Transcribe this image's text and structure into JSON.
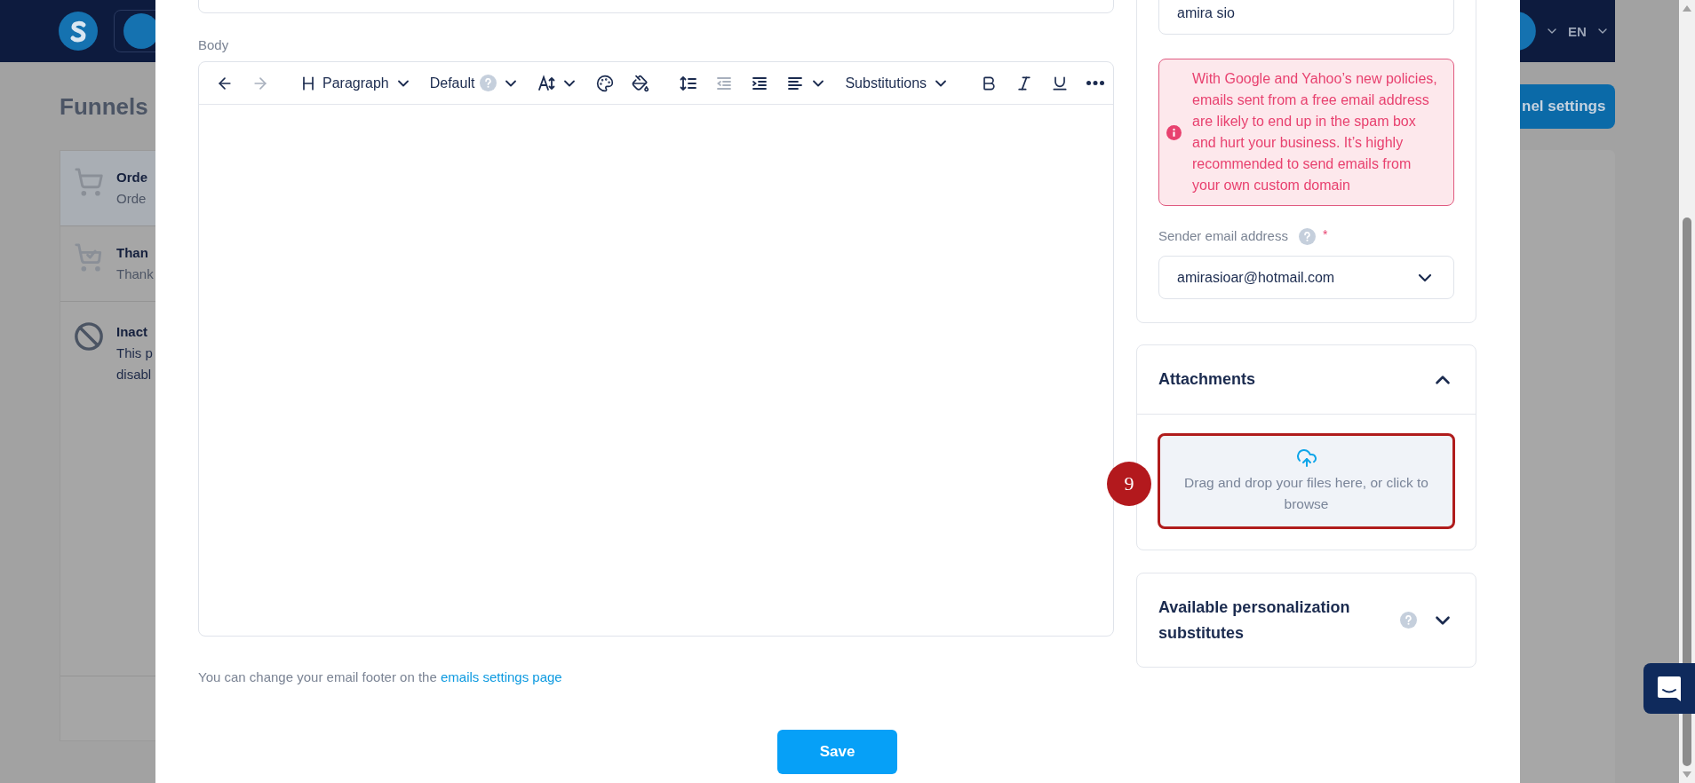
{
  "background": {
    "header": {
      "language": "EN"
    },
    "page_title": "Funnels",
    "funnel_steps": [
      {
        "kind": "cart",
        "title": "Orde",
        "lines": [
          "Orde"
        ],
        "selected": true
      },
      {
        "kind": "cart-check",
        "title": "Than",
        "lines": [
          "Thank"
        ],
        "selected": false
      },
      {
        "kind": "inactive",
        "title": "Inact",
        "lines": [
          "This p",
          "disabl"
        ],
        "selected": false
      }
    ],
    "settings_button": "nel settings"
  },
  "modal": {
    "body": {
      "label": "Body",
      "toolbar": [
        {
          "kind": "undo",
          "disabled": false
        },
        {
          "kind": "redo",
          "disabled": true
        },
        {
          "kind": "divider"
        },
        {
          "kind": "block-type",
          "label": "Paragraph",
          "disabled": false
        },
        {
          "kind": "font",
          "label": "Default",
          "disabled": false
        },
        {
          "kind": "font-size",
          "disabled": false
        },
        {
          "kind": "text-color",
          "disabled": false
        },
        {
          "kind": "highlight",
          "disabled": false
        },
        {
          "kind": "divider"
        },
        {
          "kind": "line-height",
          "disabled": false
        },
        {
          "kind": "outdent",
          "disabled": true
        },
        {
          "kind": "indent",
          "disabled": false
        },
        {
          "kind": "align",
          "disabled": false
        },
        {
          "kind": "substitutions",
          "label": "Substitutions",
          "disabled": false
        },
        {
          "kind": "divider"
        },
        {
          "kind": "bold",
          "disabled": false
        },
        {
          "kind": "italic",
          "disabled": false
        },
        {
          "kind": "underline",
          "disabled": false
        },
        {
          "kind": "more",
          "disabled": false
        }
      ]
    },
    "footer_note": {
      "text": "You can change your email footer on the ",
      "link": "emails settings page"
    },
    "save_button": "Save",
    "sender_name": {
      "value": "amira sio"
    },
    "warning": "With Google and Yahoo’s new policies, emails sent from a free email address are likely to end up in the spam box and hurt your business. It’s highly recommended to send emails from your own custom domain",
    "sender_email": {
      "label": "Sender email address",
      "help": true,
      "required_mark": "*",
      "value": "amirasioar@hotmail.com"
    },
    "attachments": {
      "title": "Attachments",
      "expanded": true,
      "dropzone": "Drag and drop your files here, or click to browse",
      "highlighted": true,
      "step_badge": "9"
    },
    "personalization": {
      "title": "Available personalization substitutes",
      "help": true,
      "expanded": false
    }
  }
}
